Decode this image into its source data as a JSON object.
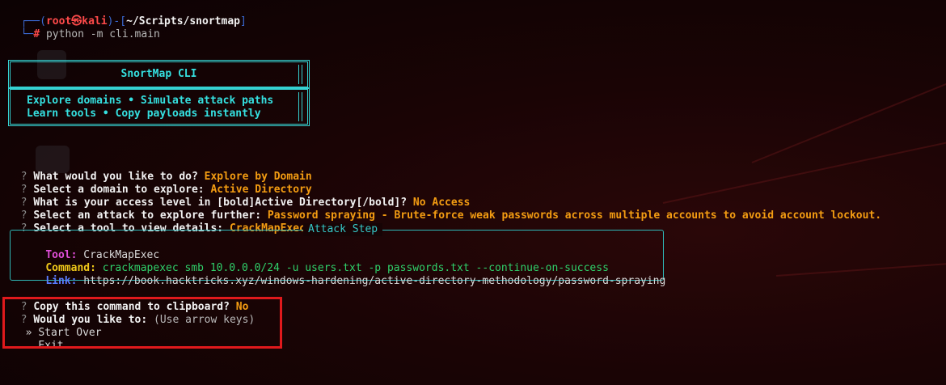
{
  "terminal": {
    "prompt": {
      "corner_top": "┌──(",
      "user": "root",
      "at_glyph": "㉿",
      "host": "kali",
      "sep": ")-[",
      "path": "~/Scripts/snortmap",
      "close": "]",
      "corner_bottom": "└─",
      "hash": "#",
      "command": " python -m cli.main"
    },
    "banner": {
      "title": "SnortMap CLI",
      "line1": "Explore domains • Simulate attack paths",
      "line2": "Learn tools • Copy payloads instantly"
    },
    "qa": [
      {
        "mark": "?",
        "question": "What would you like to do?",
        "answer": "Explore by Domain"
      },
      {
        "mark": "?",
        "question": "Select a domain to explore:",
        "answer": "Active Directory"
      },
      {
        "mark": "?",
        "question": "What is your access level in [bold]Active Directory[/bold]?",
        "answer": "No Access"
      },
      {
        "mark": "?",
        "question": "Select an attack to explore further:",
        "answer": "Password spraying - Brute-force weak passwords across multiple accounts to avoid account lockout."
      },
      {
        "mark": "?",
        "question": "Select a tool to view details:",
        "answer": "CrackMapExec"
      }
    ],
    "attack_step": {
      "title": "Attack Step",
      "tool_label": "Tool:",
      "tool_value": "CrackMapExec",
      "command_label": "Command:",
      "command_value": "crackmapexec smb 10.0.0.0/24 -u users.txt -p passwords.txt --continue-on-success",
      "link_label": "Link:",
      "link_value": "https://book.hacktricks.xyz/windows-hardening/active-directory-methodology/password-spraying"
    },
    "copy_prompt": {
      "mark": "?",
      "question": "Copy this command to clipboard?",
      "answer": "No"
    },
    "menu": {
      "mark": "?",
      "question": "Would you like to:",
      "hint": "(Use arrow keys)",
      "options": [
        {
          "pointer": "»",
          "label": "Start Over"
        },
        {
          "pointer": " ",
          "label": "Exit"
        }
      ]
    }
  },
  "colors": {
    "accent_cyan": "#35d2d2",
    "answer_orange": "#f39c12",
    "highlight_red": "#e0191c"
  }
}
